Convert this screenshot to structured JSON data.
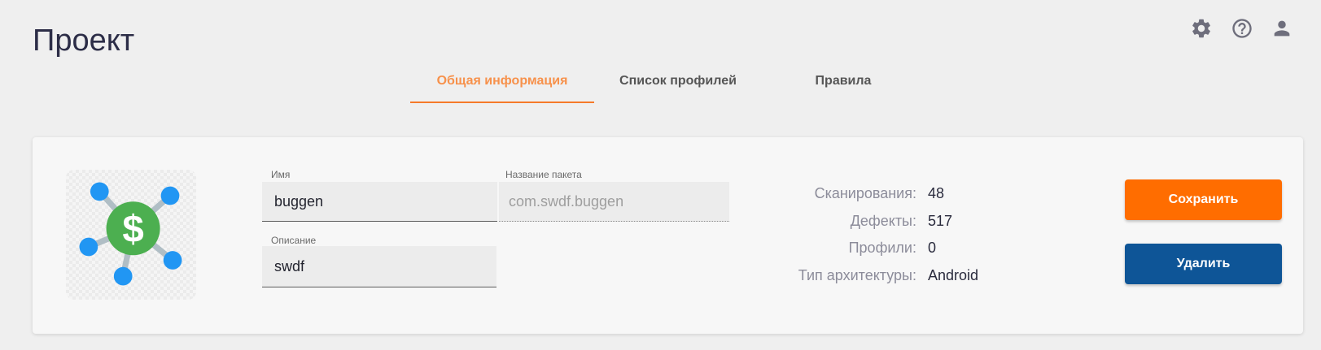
{
  "page": {
    "title": "Проект"
  },
  "header": {
    "icons": [
      "gear-icon",
      "help-icon",
      "user-icon"
    ]
  },
  "tabs": [
    {
      "label": "Общая информация",
      "active": true
    },
    {
      "label": "Список профилей",
      "active": false
    },
    {
      "label": "Правила",
      "active": false
    }
  ],
  "logo": {
    "icon": "network-dollar-icon",
    "symbol": "$"
  },
  "form": {
    "name": {
      "label": "Имя",
      "value": "buggen"
    },
    "package": {
      "label": "Название пакета",
      "value": "com.swdf.buggen",
      "disabled": true
    },
    "description": {
      "label": "Описание",
      "value": "swdf"
    }
  },
  "stats": [
    {
      "label": "Сканирования:",
      "value": "48"
    },
    {
      "label": "Дефекты:",
      "value": "517"
    },
    {
      "label": "Профили:",
      "value": "0"
    },
    {
      "label": "Тип архитектуры:",
      "value": "Android"
    }
  ],
  "actions": {
    "save_label": "Сохранить",
    "delete_label": "Удалить"
  },
  "colors": {
    "accent": "#f7914b",
    "accent_line": "#f57a2a",
    "save_button": "#ff6d00",
    "delete_button": "#0e5597"
  }
}
